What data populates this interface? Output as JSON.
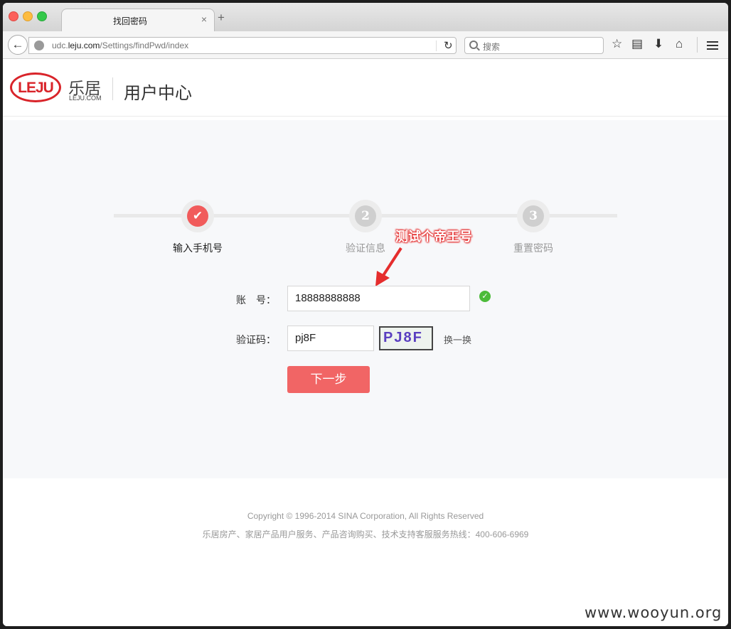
{
  "browser": {
    "tab_title": "找回密码",
    "tab_close": "×",
    "new_tab": "+",
    "url_prefix": "udc.",
    "url_domain": "leju.com",
    "url_path": "/Settings/findPwd/index",
    "search_placeholder": "搜索"
  },
  "header": {
    "logo_mark": "LEJU",
    "logo_cn": "乐居",
    "logo_en": "LEJU.COM",
    "title": "用户中心"
  },
  "steps": [
    {
      "number": "✔",
      "label": "输入手机号",
      "state": "done"
    },
    {
      "number": "2",
      "label": "验证信息",
      "state": "todo"
    },
    {
      "number": "3",
      "label": "重置密码",
      "state": "todo"
    }
  ],
  "annotation": "测试个帝王号",
  "form": {
    "account_label": "账　号：",
    "account_value": "18888888888",
    "captcha_label": "验证码：",
    "captcha_value": "pj8F",
    "captcha_image_text": "PJ8F",
    "swap_link": "换一换",
    "next_button": "下一步"
  },
  "footer": {
    "copyright": "Copyright © 1996-2014 SINA Corporation, All Rights Reserved",
    "service": "乐居房产、家居产品用户服务、产品咨询购买、技术支持客服服务热线：400-606-6969"
  },
  "watermark": "www.wooyun.org",
  "colors": {
    "accent": "#f16565",
    "success": "#4cbb3a",
    "brand_red": "#d9242a"
  }
}
